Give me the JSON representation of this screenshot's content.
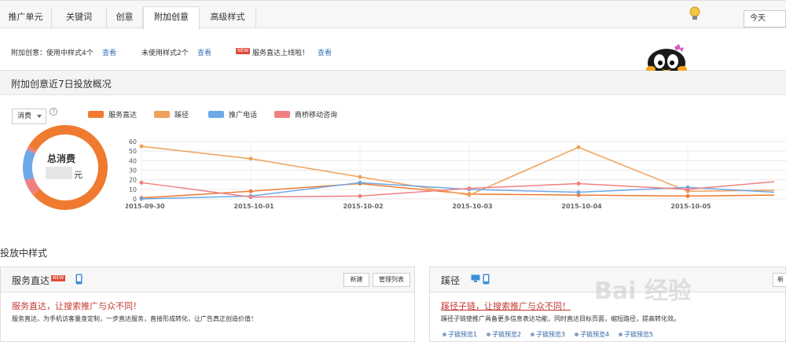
{
  "tabs": [
    {
      "label": "推广单元",
      "active": false
    },
    {
      "label": "关键词",
      "active": false
    },
    {
      "label": "创意",
      "active": false
    },
    {
      "label": "附加创意",
      "active": true
    },
    {
      "label": "高级样式",
      "active": false
    }
  ],
  "date_select": {
    "value": "今天"
  },
  "info_row": {
    "in_use": "附加创意：使用中样式4个",
    "in_use_link": "查看",
    "not_in_use": "未使用样式2个",
    "not_in_use_link": "查看",
    "new_badge": "NEW",
    "promo": "服务直达上线啦！",
    "promo_link": "查看"
  },
  "overview": {
    "title": "附加创意近7日投放概况",
    "metric_select": "消费",
    "help": "?",
    "total_label": "总消费",
    "total_unit": "元"
  },
  "colors": {
    "fuwu": "#f07b30",
    "qijing": "#f0a05a",
    "dianhua": "#6ea8e8",
    "shangqiao": "#f08080"
  },
  "chart_data": {
    "type": "line",
    "x": [
      "2015-09-30",
      "2015-10-01",
      "2015-10-02",
      "2015-10-03",
      "2015-10-04",
      "2015-10-05"
    ],
    "ylim": [
      0,
      60
    ],
    "yticks": [
      0,
      10,
      20,
      30,
      40,
      50,
      60
    ],
    "grid": true,
    "legend": "top",
    "series": [
      {
        "name": "服务直达",
        "color": "#f07b30",
        "values": [
          1,
          8,
          16,
          5,
          4,
          3
        ]
      },
      {
        "name": "蹊径",
        "color": "#f0a05a",
        "values": [
          55,
          42,
          23,
          4,
          54,
          8
        ]
      },
      {
        "name": "推广电话",
        "color": "#6ea8e8",
        "values": [
          0,
          3,
          17,
          10,
          7,
          12
        ]
      },
      {
        "name": "商桥移动咨询",
        "color": "#f08080",
        "values": [
          17,
          2,
          3,
          11,
          16,
          10
        ]
      }
    ],
    "donut": [
      {
        "name": "服务直达",
        "color": "#f07b30",
        "value": 0.6
      },
      {
        "name": "蹊径",
        "color": "#f07b30",
        "value": 0.62
      },
      {
        "name": "推广电话",
        "color": "#6ea8e8",
        "value": 0.14
      },
      {
        "name": "商桥移动咨询",
        "color": "#f08080",
        "value": 0.24
      }
    ]
  },
  "delivery": {
    "title": "投放中样式",
    "fuwu": {
      "title": "服务直达",
      "badge": "NEW",
      "btn_new": "新建",
      "btn_manage": "管理列表",
      "link_title": "服务直达，让搜索推广与众不同！",
      "desc": "服务直达，为手机访客量身定制，一步直达服务，直接形成转化，让广告真正创造价值！"
    },
    "qijing": {
      "title": "蹊径",
      "btn_new": "新",
      "link_title": "蹊径子链，让搜索推广与众不同！",
      "desc": "蹊径子链使推广具备更多信息表达功能，同时直达目标页面，缩短路径，提高转化效。",
      "sublinks": [
        "子链预览1",
        "子链预览2",
        "子链预览3",
        "子链预览4",
        "子链预览5"
      ]
    }
  },
  "watermark": "Bai 经验"
}
